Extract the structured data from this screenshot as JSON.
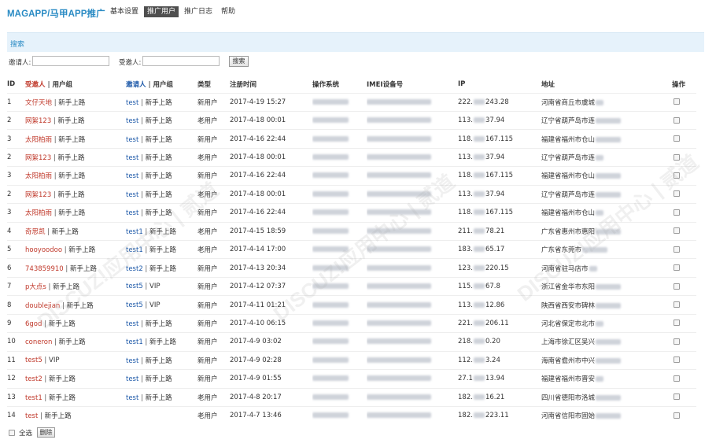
{
  "header": {
    "brand": "MAGAPP/马甲APP推广",
    "nav": [
      "基本设置",
      "推广用户",
      "推广日志",
      "帮助"
    ],
    "active_nav": "推广用户"
  },
  "search": {
    "title": "搜索",
    "inviter_label": "邀请人:",
    "invitee_label": "受邀人:",
    "inviter_value": "",
    "invitee_value": "",
    "button_label": "搜索"
  },
  "table": {
    "headers": {
      "id": "ID",
      "invitee": "受邀人",
      "invitee_group": "用户组",
      "inviter": "邀请人",
      "inviter_group": "用户组",
      "type": "类型",
      "reg_time": "注册时间",
      "os": "操作系统",
      "imei": "IMEI设备号",
      "ip": "IP",
      "address": "地址",
      "action": "操作"
    },
    "rows": [
      {
        "id": "1",
        "invitee": "文仔天地",
        "invitee_group": "新手上路",
        "inviter": "test",
        "inviter_group": "新手上路",
        "type": "新用户",
        "time": "2017-4-19 15:27",
        "ip_a": "222.",
        "ip_b": "243.28",
        "addr": "河南省商丘市虞城"
      },
      {
        "id": "2",
        "invitee": "网絮123",
        "invitee_group": "新手上路",
        "inviter": "test",
        "inviter_group": "新手上路",
        "type": "老用户",
        "time": "2017-4-18 00:01",
        "ip_a": "113.",
        "ip_b": "37.94",
        "addr": "辽宁省葫芦岛市连"
      },
      {
        "id": "3",
        "invitee": "太阳柏雨",
        "invitee_group": "新手上路",
        "inviter": "test",
        "inviter_group": "新手上路",
        "type": "新用户",
        "time": "2017-4-16 22:44",
        "ip_a": "118.",
        "ip_b": "167.115",
        "addr": "福建省福州市仓山"
      },
      {
        "id": "2",
        "invitee": "网絮123",
        "invitee_group": "新手上路",
        "inviter": "test",
        "inviter_group": "新手上路",
        "type": "老用户",
        "time": "2017-4-18 00:01",
        "ip_a": "113.",
        "ip_b": "37.94",
        "addr": "辽宁省葫芦岛市连"
      },
      {
        "id": "3",
        "invitee": "太阳柏雨",
        "invitee_group": "新手上路",
        "inviter": "test",
        "inviter_group": "新手上路",
        "type": "新用户",
        "time": "2017-4-16 22:44",
        "ip_a": "118.",
        "ip_b": "167.115",
        "addr": "福建省福州市仓山"
      },
      {
        "id": "2",
        "invitee": "网絮123",
        "invitee_group": "新手上路",
        "inviter": "test",
        "inviter_group": "新手上路",
        "type": "老用户",
        "time": "2017-4-18 00:01",
        "ip_a": "113.",
        "ip_b": "37.94",
        "addr": "辽宁省葫芦岛市连"
      },
      {
        "id": "3",
        "invitee": "太阳柏雨",
        "invitee_group": "新手上路",
        "inviter": "test",
        "inviter_group": "新手上路",
        "type": "新用户",
        "time": "2017-4-16 22:44",
        "ip_a": "118.",
        "ip_b": "167.115",
        "addr": "福建省福州市仓山"
      },
      {
        "id": "4",
        "invitee": "奇思凯",
        "invitee_group": "新手上路",
        "inviter": "test1",
        "inviter_group": "新手上路",
        "type": "老用户",
        "time": "2017-4-15 18:59",
        "ip_a": "211.",
        "ip_b": "78.21",
        "addr": "广东省惠州市惠阳"
      },
      {
        "id": "5",
        "invitee": "hooyoodoo",
        "invitee_group": "新手上路",
        "inviter": "test1",
        "inviter_group": "新手上路",
        "type": "老用户",
        "time": "2017-4-14 17:00",
        "ip_a": "183.",
        "ip_b": "65.17",
        "addr": "广东省东莞市"
      },
      {
        "id": "6",
        "invitee": "743859910",
        "invitee_group": "新手上路",
        "inviter": "test2",
        "inviter_group": "新手上路",
        "type": "新用户",
        "time": "2017-4-13 20:34",
        "ip_a": "123.",
        "ip_b": "220.15",
        "addr": "河南省驻马店市"
      },
      {
        "id": "7",
        "invitee": "p大点s",
        "invitee_group": "新手上路",
        "inviter": "test5",
        "inviter_group": "VIP",
        "type": "新用户",
        "time": "2017-4-12 07:37",
        "ip_a": "115.",
        "ip_b": "67.8",
        "addr": "浙江省金华市东阳"
      },
      {
        "id": "8",
        "invitee": "doublejian",
        "invitee_group": "新手上路",
        "inviter": "test5",
        "inviter_group": "VIP",
        "type": "新用户",
        "time": "2017-4-11 01:21",
        "ip_a": "113.",
        "ip_b": "12.86",
        "addr": "陕西省西安市碑林"
      },
      {
        "id": "9",
        "invitee": "6god",
        "invitee_group": "新手上路",
        "inviter": "test",
        "inviter_group": "新手上路",
        "type": "新用户",
        "time": "2017-4-10 06:15",
        "ip_a": "221.",
        "ip_b": "206.11",
        "addr": "河北省保定市北市"
      },
      {
        "id": "10",
        "invitee": "coneron",
        "invitee_group": "新手上路",
        "inviter": "test1",
        "inviter_group": "新手上路",
        "type": "新用户",
        "time": "2017-4-9 03:02",
        "ip_a": "218.",
        "ip_b": "0.20",
        "addr": "上海市徐汇区吴兴"
      },
      {
        "id": "11",
        "invitee": "test5",
        "invitee_group": "VIP",
        "inviter": "test",
        "inviter_group": "新手上路",
        "type": "新用户",
        "time": "2017-4-9 02:28",
        "ip_a": "112.",
        "ip_b": "3.24",
        "addr": "海南省儋州市中兴"
      },
      {
        "id": "12",
        "invitee": "test2",
        "invitee_group": "新手上路",
        "inviter": "test",
        "inviter_group": "新手上路",
        "type": "新用户",
        "time": "2017-4-9 01:55",
        "ip_a": "27.1",
        "ip_b": "13.94",
        "addr": "福建省福州市晋安"
      },
      {
        "id": "13",
        "invitee": "test1",
        "invitee_group": "新手上路",
        "inviter": "test",
        "inviter_group": "新手上路",
        "type": "老用户",
        "time": "2017-4-8 20:17",
        "ip_a": "182.",
        "ip_b": "16.21",
        "addr": "四川省德阳市洛城"
      },
      {
        "id": "14",
        "invitee": "test",
        "invitee_group": "新手上路",
        "inviter": "",
        "inviter_group": "",
        "type": "老用户",
        "time": "2017-4-7 13:46",
        "ip_a": "182.",
        "ip_b": "223.11",
        "addr": "河南省信阳市固始"
      }
    ]
  },
  "footer": {
    "select_all_label": "全选",
    "delete_label": "删除"
  },
  "watermark": "DISCUZ!应用中心 | 贰道 addon.discuz.com",
  "colors": {
    "brand": "#2a8bc4",
    "invitee_link": "#c0392b",
    "inviter_link": "#1c58a8",
    "search_bg": "#e6f2fb",
    "nav_active_bg": "#4f4f4f"
  }
}
